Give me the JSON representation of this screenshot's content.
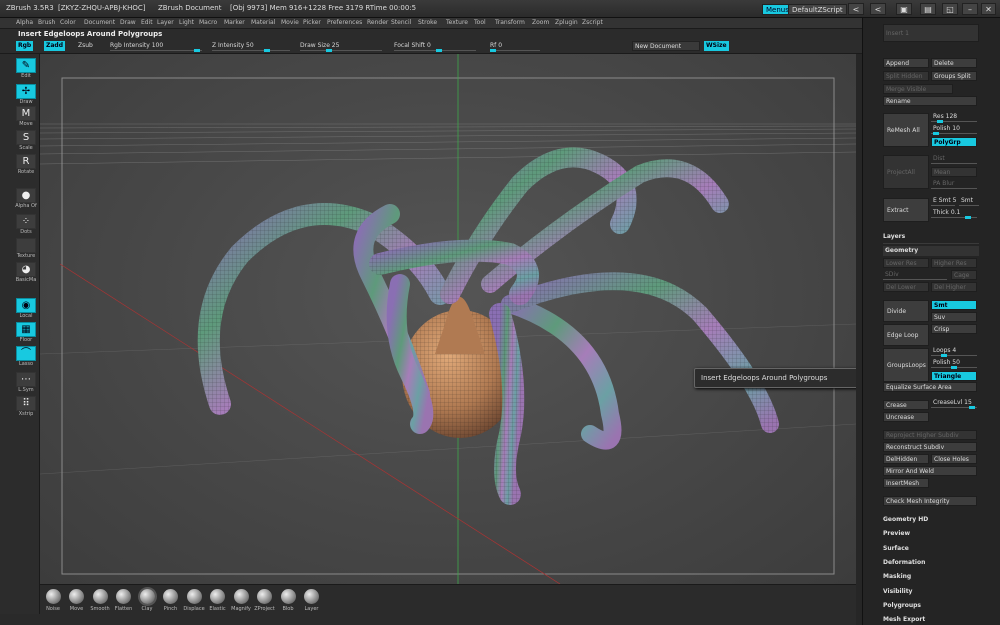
{
  "titlebar": {
    "app": "ZBrush 3.5R3",
    "serial": "[ZKYZ-ZHQU-APBJ-KHOC]",
    "doc": "ZBrush Document",
    "stats": "[Obj 9973]  Mem 916+1228  Free 3179  RTime 00:00:5",
    "menus_btn": "Menus",
    "script_btn": "DefaultZScript",
    "win_buttons": [
      "<",
      "<",
      "▣",
      "▤",
      "◱",
      "–",
      "✕"
    ]
  },
  "menubar": [
    "Alpha",
    "Brush",
    "Color",
    "Document",
    "Draw",
    "Edit",
    "Layer",
    "Light",
    "Macro",
    "Marker",
    "Material",
    "Movie",
    "Picker",
    "Preferences",
    "Render",
    "Stencil",
    "Stroke",
    "Texture",
    "Tool",
    "Transform",
    "Zoom",
    "Zplugin",
    "Zscript"
  ],
  "tip_label": "Insert Edgeloops Around Polygroups",
  "toolbar": {
    "rgb": "Rgb",
    "zadd": "Zadd",
    "zsub": "Zsub",
    "rgb_intensity": "Rgb Intensity 100",
    "z_intensity": "Z Intensity 50",
    "draw_size": "Draw Size 25",
    "focal_shift": "Focal Shift 0",
    "rf": "Rf 0",
    "new_document": "New Document",
    "wsize": "WSize"
  },
  "left_shelf": [
    {
      "label": "Edit",
      "icon": "edit-icon",
      "on": true,
      "glyph": "✎"
    },
    {
      "label": "Draw",
      "icon": "draw-icon",
      "on": true,
      "glyph": "✢"
    },
    {
      "label": "Move",
      "icon": "move-icon",
      "on": false,
      "glyph": "M"
    },
    {
      "label": "Scale",
      "icon": "scale-icon",
      "on": false,
      "glyph": "S"
    },
    {
      "label": "Rotate",
      "icon": "rotate-icon",
      "on": false,
      "glyph": "R"
    },
    {
      "label": "Alpha  Of",
      "icon": "alpha-icon",
      "on": false,
      "glyph": "●"
    },
    {
      "label": "Dots",
      "icon": "dots-icon",
      "on": false,
      "glyph": "⁘"
    },
    {
      "label": "Texture",
      "icon": "texture-icon",
      "on": false,
      "glyph": ""
    },
    {
      "label": "BasicMa",
      "icon": "material-icon",
      "on": false,
      "glyph": "◕"
    },
    {
      "label": "Local",
      "icon": "local-icon",
      "on": true,
      "glyph": "◉"
    },
    {
      "label": "Floor",
      "icon": "floor-icon",
      "on": true,
      "glyph": "▦"
    },
    {
      "label": "Lasso",
      "icon": "lasso-icon",
      "on": true,
      "glyph": "⌒"
    },
    {
      "label": "L.Sym",
      "icon": "lsym-icon",
      "on": false,
      "glyph": "⋯"
    },
    {
      "label": "Xstrip",
      "icon": "xstrip-icon",
      "on": false,
      "glyph": "⠿"
    }
  ],
  "tooltip": "Insert Edgeloops Around Polygroups",
  "bottom_brushes": [
    "Noise",
    "Move",
    "Smooth",
    "Flatten",
    "Clay",
    "Pinch",
    "Displace",
    "Elastic",
    "Magnify",
    "ZProject",
    "Blob",
    "Layer"
  ],
  "tray": {
    "top_input": "Insert 1",
    "append": "Append",
    "delete": "Delete",
    "split_hidden": "Split Hidden",
    "groups_split": "Groups Split",
    "merge_visible": "Merge Visible",
    "rename": "Rename",
    "remesh_all": "ReMesh All",
    "res": "Res 128",
    "polish": "Polish 10",
    "polygrp": "PolyGrp",
    "project_all": "ProjectAll",
    "dist": "Dist",
    "mean": "Mean",
    "pa_blur": "PA Blur",
    "extract": "Extract",
    "e_smt": "E Smt 5",
    "s_smt": "Smt",
    "thick": "Thick 0.1",
    "layers": "Layers",
    "geometry": "Geometry",
    "lower_res": "Lower Res",
    "higher_res": "Higher Res",
    "sdiv": "SDiv",
    "cage": "Cage",
    "del_lower": "Del Lower",
    "del_higher": "Del Higher",
    "divide": "Divide",
    "smt": "Smt",
    "suv": "Suv",
    "edge_loop": "Edge Loop",
    "crisp": "Crisp",
    "groups_loops": "GroupsLoops",
    "loops": "Loops 4",
    "polish2": "Polish 50",
    "triangle": "Triangle",
    "equalize": "Equalize Surface Area",
    "crease": "Crease",
    "creaselvl": "CreaseLvl 15",
    "uncrease": "Uncrease",
    "reproject": "Reproject Higher Subdiv",
    "reconstruct": "Reconstruct Subdiv",
    "delhidden": "DelHidden",
    "close_holes": "Close Holes",
    "mirror_weld": "Mirror And Weld",
    "insertmesh": "InsertMesh",
    "check_mesh": "Check Mesh Integrity",
    "sections": [
      "Geometry HD",
      "Preview",
      "Surface",
      "Deformation",
      "Masking",
      "Visibility",
      "Polygroups",
      "Mesh Export"
    ]
  },
  "colors": {
    "accent": "#18c9e0"
  }
}
